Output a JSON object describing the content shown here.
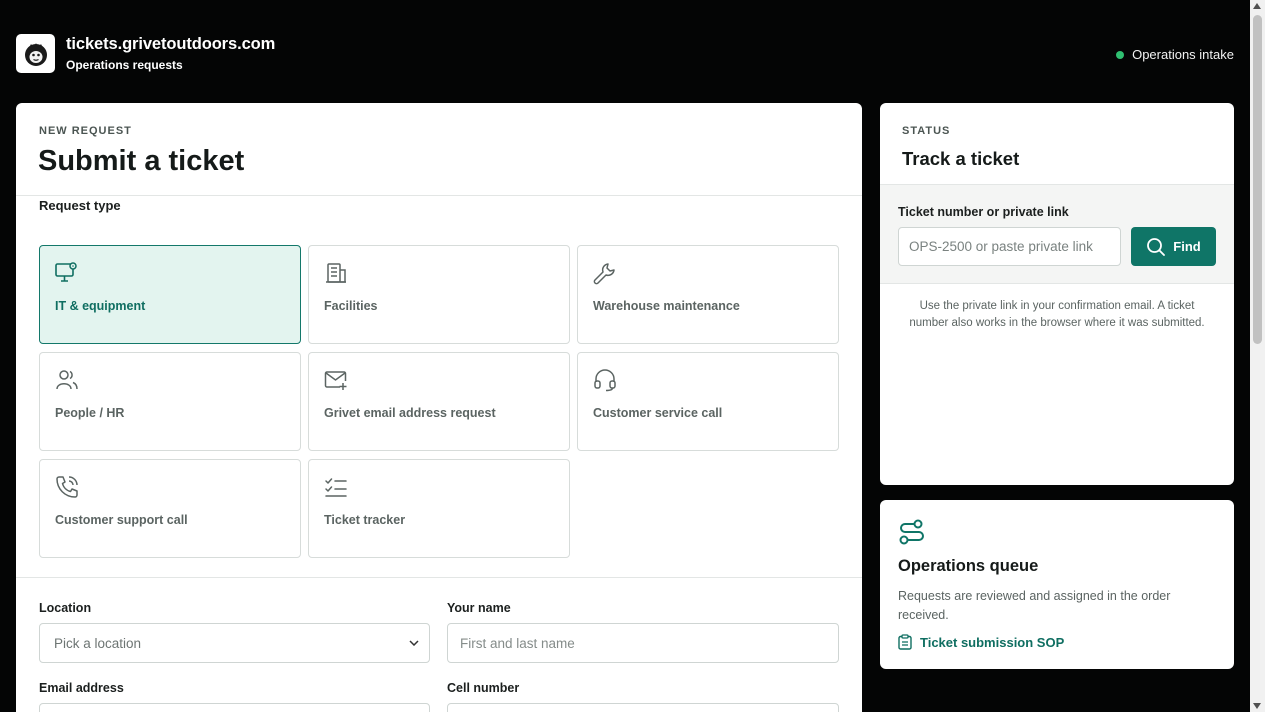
{
  "header": {
    "site_title": "tickets.grivetoutdoors.com",
    "site_subtitle": "Operations requests",
    "status_text": "Operations intake"
  },
  "form": {
    "eyebrow": "NEW REQUEST",
    "title": "Submit a ticket",
    "request_type_label": "Request type",
    "request_types": [
      {
        "label": "IT & equipment",
        "icon": "monitor-gear-icon",
        "selected": true
      },
      {
        "label": "Facilities",
        "icon": "building-icon",
        "selected": false
      },
      {
        "label": "Warehouse maintenance",
        "icon": "wrench-icon",
        "selected": false
      },
      {
        "label": "People / HR",
        "icon": "people-icon",
        "selected": false
      },
      {
        "label": "Grivet email address request",
        "icon": "mail-plus-icon",
        "selected": false
      },
      {
        "label": "Customer service call",
        "icon": "headset-icon",
        "selected": false
      },
      {
        "label": "Customer support call",
        "icon": "phone-call-icon",
        "selected": false
      },
      {
        "label": "Ticket tracker",
        "icon": "checklist-icon",
        "selected": false
      }
    ],
    "location_label": "Location",
    "location_placeholder": "Pick a location",
    "name_label": "Your name",
    "name_placeholder": "First and last name",
    "email_label": "Email address",
    "cell_label": "Cell number"
  },
  "track": {
    "eyebrow": "STATUS",
    "title": "Track a ticket",
    "field_label": "Ticket number or private link",
    "placeholder": "OPS-2500 or paste private link",
    "find_label": "Find",
    "help_text": "Use the private link in your confirmation email. A ticket number also works in the browser where it was submitted."
  },
  "queue": {
    "title": "Operations queue",
    "description": "Requests are reviewed and assigned in the order received.",
    "sop_link": "Ticket submission SOP"
  },
  "colors": {
    "accent": "#0f7567",
    "selected_bg": "#e3f4ef",
    "status_dot": "#2fbf71",
    "header_bg": "#040505"
  }
}
